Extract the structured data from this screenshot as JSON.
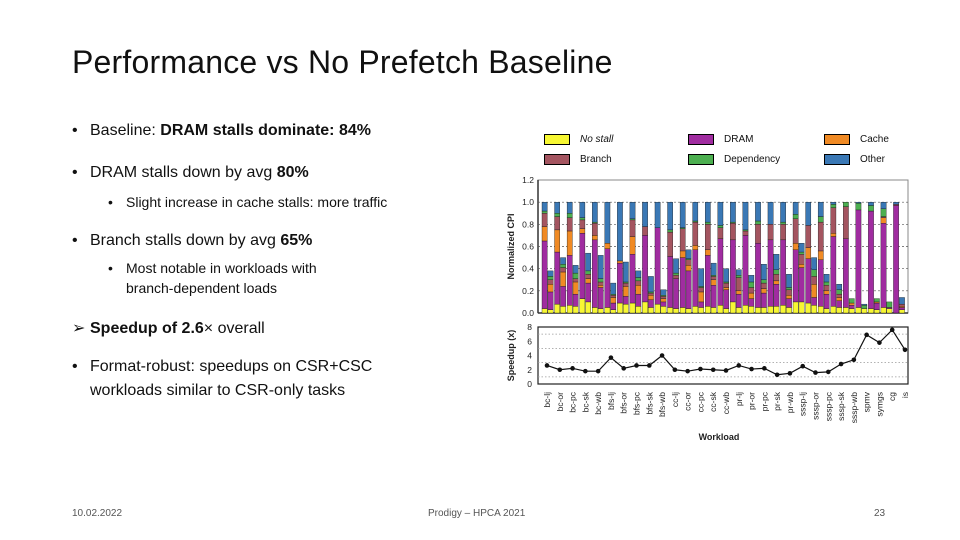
{
  "slide": {
    "title": "Performance vs No Prefetch Baseline",
    "bullets": [
      {
        "level": 1,
        "marker": "•",
        "parts": [
          {
            "text": "Baseline: ",
            "bold": false
          },
          {
            "text": "DRAM stalls dominate: 84%",
            "bold": true
          }
        ]
      },
      {
        "level": 1,
        "marker": "•",
        "parts": [
          {
            "text": "DRAM stalls down by avg ",
            "bold": false
          },
          {
            "text": "80%",
            "bold": true
          }
        ]
      },
      {
        "level": 2,
        "marker": "•",
        "parts": [
          {
            "text": "Slight increase in cache stalls: more traffic",
            "bold": false
          }
        ]
      },
      {
        "level": 1,
        "marker": "•",
        "parts": [
          {
            "text": "Branch stalls down by avg ",
            "bold": false
          },
          {
            "text": "65%",
            "bold": true
          }
        ]
      },
      {
        "level": 2,
        "marker": "•",
        "parts": [
          {
            "text": "Most notable in workloads with",
            "bold": false
          }
        ]
      },
      {
        "level": 2,
        "marker": "",
        "parts": [
          {
            "text": "branch-dependent loads",
            "bold": false
          }
        ]
      },
      {
        "level": 1,
        "marker": "➢",
        "parts": [
          {
            "text": "Speedup of 2.6",
            "bold": true
          },
          {
            "text": "× overall",
            "bold": false
          }
        ]
      },
      {
        "level": 1,
        "marker": "•",
        "parts": [
          {
            "text": "Format-robust: speedups on CSR+CSC",
            "bold": false
          }
        ]
      },
      {
        "level": 1,
        "marker": "",
        "parts": [
          {
            "text": "workloads similar to CSR-only tasks",
            "bold": false
          }
        ]
      }
    ],
    "footer": {
      "date": "10.02.2022",
      "center": "Prodigy – HPCA 2021",
      "page": "23"
    }
  },
  "legend": [
    {
      "label": "No stall",
      "color": "#f7f733",
      "italic": true
    },
    {
      "label": "DRAM",
      "color": "#a02ca0",
      "italic": false
    },
    {
      "label": "Cache",
      "color": "#f08a24",
      "italic": false
    },
    {
      "label": "Branch",
      "color": "#a45560",
      "italic": false
    },
    {
      "label": "Dependency",
      "color": "#4caf50",
      "italic": false
    },
    {
      "label": "Other",
      "color": "#3a78b5",
      "italic": false
    }
  ],
  "chart_data": [
    {
      "type": "bar",
      "stacked": true,
      "title": "",
      "xlabel": "Workload",
      "ylabel": "Normalized CPI",
      "ylim": [
        0,
        1.2
      ],
      "yticks": [
        "0.0",
        "0.2",
        "0.4",
        "0.6",
        "0.8",
        "1.0",
        "1.2"
      ],
      "grid": "dotted-horizontal",
      "note": "Each workload has two bars: baseline (left, normalized to 1.0) and Prodigy (right).",
      "categories": [
        "bc-lj",
        "bc-or",
        "bc-pc",
        "bc-sk",
        "bc-wb",
        "bfs-lj",
        "bfs-or",
        "bfs-pc",
        "bfs-sk",
        "bfs-wb",
        "cc-lj",
        "cc-or",
        "cc-pc",
        "cc-sk",
        "cc-wb",
        "pr-lj",
        "pr-or",
        "pr-pc",
        "pr-sk",
        "pr-wb",
        "sssp-lj",
        "sssp-or",
        "sssp-pc",
        "sssp-sk",
        "sssp-wb",
        "spmv",
        "symgs",
        "cg",
        "is"
      ],
      "stack_order": [
        "No stall",
        "DRAM",
        "Cache",
        "Branch",
        "Dependency",
        "Other"
      ],
      "baseline": [
        [
          0.04,
          0.61,
          0.13,
          0.12,
          0.02,
          0.08
        ],
        [
          0.08,
          0.47,
          0.2,
          0.12,
          0.03,
          0.1
        ],
        [
          0.07,
          0.45,
          0.22,
          0.12,
          0.04,
          0.1
        ],
        [
          0.13,
          0.59,
          0.04,
          0.08,
          0.02,
          0.14
        ],
        [
          0.05,
          0.61,
          0.04,
          0.11,
          0.01,
          0.18
        ],
        [
          0.05,
          0.53,
          0.05,
          0.0,
          0.0,
          0.37
        ],
        [
          0.09,
          0.36,
          0.02,
          0.0,
          0.0,
          0.53
        ],
        [
          0.09,
          0.44,
          0.16,
          0.15,
          0.01,
          0.15
        ],
        [
          0.1,
          0.6,
          0.0,
          0.08,
          0.0,
          0.22
        ],
        [
          0.08,
          0.69,
          0.0,
          0.0,
          0.0,
          0.23
        ],
        [
          0.05,
          0.46,
          0.0,
          0.22,
          0.02,
          0.25
        ],
        [
          0.05,
          0.45,
          0.06,
          0.2,
          0.01,
          0.23
        ],
        [
          0.06,
          0.51,
          0.04,
          0.21,
          0.01,
          0.17
        ],
        [
          0.06,
          0.46,
          0.05,
          0.23,
          0.02,
          0.18
        ],
        [
          0.07,
          0.6,
          0.0,
          0.1,
          0.02,
          0.21
        ],
        [
          0.1,
          0.56,
          0.0,
          0.15,
          0.01,
          0.18
        ],
        [
          0.07,
          0.63,
          0.0,
          0.04,
          0.01,
          0.25
        ],
        [
          0.05,
          0.58,
          0.0,
          0.17,
          0.03,
          0.17
        ],
        [
          0.06,
          0.6,
          0.0,
          0.14,
          0.0,
          0.2
        ],
        [
          0.07,
          0.59,
          0.0,
          0.14,
          0.02,
          0.18
        ],
        [
          0.1,
          0.47,
          0.06,
          0.22,
          0.04,
          0.11
        ],
        [
          0.09,
          0.4,
          0.1,
          0.2,
          0.0,
          0.21
        ],
        [
          0.06,
          0.42,
          0.08,
          0.26,
          0.05,
          0.13
        ],
        [
          0.06,
          0.63,
          0.03,
          0.23,
          0.03,
          0.02
        ],
        [
          0.05,
          0.62,
          0.0,
          0.29,
          0.04,
          0.0
        ],
        [
          0.05,
          0.88,
          0.0,
          0.0,
          0.06,
          0.01
        ],
        [
          0.04,
          0.88,
          0.0,
          0.0,
          0.05,
          0.03
        ],
        [
          0.05,
          0.76,
          0.05,
          0.01,
          0.07,
          0.06
        ],
        [
          0.0,
          0.97,
          0.0,
          0.01,
          0.0,
          0.02
        ]
      ],
      "prodigy": [
        [
          0.03,
          0.16,
          0.07,
          0.04,
          0.03,
          0.05
        ],
        [
          0.06,
          0.18,
          0.13,
          0.04,
          0.03,
          0.06
        ],
        [
          0.06,
          0.11,
          0.11,
          0.03,
          0.05,
          0.07
        ],
        [
          0.1,
          0.17,
          0.04,
          0.04,
          0.03,
          0.16
        ],
        [
          0.04,
          0.19,
          0.02,
          0.03,
          0.03,
          0.21
        ],
        [
          0.03,
          0.06,
          0.05,
          0.02,
          0.01,
          0.1
        ],
        [
          0.08,
          0.07,
          0.09,
          0.03,
          0.01,
          0.18
        ],
        [
          0.06,
          0.11,
          0.08,
          0.04,
          0.03,
          0.06
        ],
        [
          0.05,
          0.07,
          0.04,
          0.02,
          0.01,
          0.14
        ],
        [
          0.06,
          0.04,
          0.03,
          0.02,
          0.01,
          0.05
        ],
        [
          0.04,
          0.27,
          0.0,
          0.03,
          0.02,
          0.13
        ],
        [
          0.04,
          0.34,
          0.05,
          0.05,
          0.01,
          0.08
        ],
        [
          0.05,
          0.05,
          0.09,
          0.04,
          0.01,
          0.16
        ],
        [
          0.05,
          0.2,
          0.05,
          0.03,
          0.01,
          0.11
        ],
        [
          0.04,
          0.17,
          0.02,
          0.04,
          0.01,
          0.12
        ],
        [
          0.05,
          0.12,
          0.03,
          0.12,
          0.02,
          0.05
        ],
        [
          0.06,
          0.07,
          0.05,
          0.05,
          0.05,
          0.06
        ],
        [
          0.05,
          0.13,
          0.04,
          0.05,
          0.03,
          0.14
        ],
        [
          0.06,
          0.2,
          0.03,
          0.06,
          0.04,
          0.14
        ],
        [
          0.05,
          0.08,
          0.03,
          0.05,
          0.02,
          0.12
        ],
        [
          0.1,
          0.31,
          0.03,
          0.09,
          0.02,
          0.08
        ],
        [
          0.07,
          0.07,
          0.12,
          0.07,
          0.06,
          0.11
        ],
        [
          0.04,
          0.13,
          0.03,
          0.05,
          0.03,
          0.07
        ],
        [
          0.05,
          0.06,
          0.03,
          0.03,
          0.04,
          0.05
        ],
        [
          0.04,
          0.03,
          0.02,
          0.0,
          0.04,
          0.0
        ],
        [
          0.04,
          0.0,
          0.0,
          0.0,
          0.03,
          0.01
        ],
        [
          0.03,
          0.06,
          0.01,
          0.0,
          0.03,
          0.0
        ],
        [
          0.04,
          0.01,
          0.0,
          0.0,
          0.05,
          0.0
        ],
        [
          0.03,
          0.02,
          0.01,
          0.02,
          0.0,
          0.06
        ]
      ]
    },
    {
      "type": "line",
      "title": "",
      "xlabel": "Workload",
      "ylabel": "Speedup (x)",
      "ylim": [
        0,
        8
      ],
      "yticks": [
        "0",
        "2",
        "4",
        "6",
        "8"
      ],
      "grid": "dotted-horizontal",
      "categories": [
        "bc-lj",
        "bc-or",
        "bc-pc",
        "bc-sk",
        "bc-wb",
        "bfs-lj",
        "bfs-or",
        "bfs-pc",
        "bfs-sk",
        "bfs-wb",
        "cc-lj",
        "cc-or",
        "cc-pc",
        "cc-sk",
        "cc-wb",
        "pr-lj",
        "pr-or",
        "pr-pc",
        "pr-sk",
        "pr-wb",
        "sssp-lj",
        "sssp-or",
        "sssp-pc",
        "sssp-sk",
        "sssp-wb",
        "spmv",
        "symgs",
        "cg",
        "is"
      ],
      "series": [
        {
          "name": "Speedup",
          "values": [
            2.6,
            2.0,
            2.2,
            1.8,
            1.8,
            3.7,
            2.2,
            2.6,
            2.6,
            4.0,
            2.0,
            1.8,
            2.1,
            2.0,
            1.9,
            2.6,
            2.1,
            2.2,
            1.3,
            1.5,
            2.5,
            1.6,
            1.7,
            2.8,
            3.4,
            6.9,
            5.8,
            7.6,
            4.8
          ]
        }
      ]
    }
  ]
}
